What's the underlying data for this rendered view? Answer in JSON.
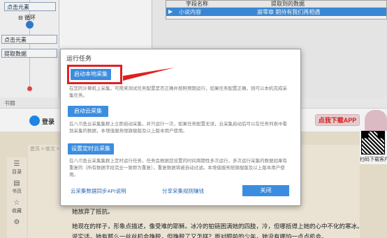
{
  "workflow": {
    "nodes": [
      "点击元素",
      "点击元素",
      "提取数据"
    ],
    "loop_label": "循环"
  },
  "grid": {
    "columns": [
      "字段名称",
      "提取到的数据"
    ],
    "rows": [
      {
        "name": "小说内容",
        "value": "崩零章 期待有我们再相遇"
      }
    ]
  },
  "browser": {
    "tab_label": "书籍",
    "login_label": "登录",
    "app_button": "点我下载APP",
    "qr_label": "扫码下载客户端",
    "breadcrumb": "首页 > 收文 >",
    "sidebar": [
      {
        "icon": "list-icon",
        "label": "目录"
      },
      {
        "icon": "page-icon",
        "label": "书页"
      },
      {
        "icon": "star-icon",
        "label": "收藏"
      },
      {
        "icon": "gear-icon",
        "label": ""
      }
    ],
    "paragraphs": [
      "她放弃了抵抗。",
      "她现在的样子，形象点描述，像受难的耶稣。冰冷的铂链困满她的四肢，冷，但哪抵得上她的心中不化的寒冰。",
      "说实话，她有那么一丝丝机会挣脱，但挣脱了又怎样？面对眼前的少年，她没有哪怕一点点机会。"
    ]
  },
  "modal": {
    "title": "运行任务",
    "local_button": "启动本地采集",
    "local_desc": "在您的计算机上采集，可用来测试任务配置是否正确并按照预期运行，如果任务配置正确，则可以本机完成采集任务。",
    "cloud_button": "启动云采集",
    "cloud_desc": "在八爪鱼云采集集群上立即启动采集，并只运行一次，如果任务配置无误，云采集启动后可以在任务列表中看到采集的数据，本增值服务限旗舰版及以上版本用户使用。",
    "schedule_button": "设置定时云采集",
    "schedule_desc": "在八爪鱼云采集集群上定时运行任务，任务会根据您设置的时间周期性多次运行，多次运行采集的数据如果有重复的（所有数据字段完全一致即为重复），重复数据将被自动过滤。本增值服务限旗舰版及以上版本用户使用。",
    "api_link": "云采集数据同步API说明",
    "share_link": "分享采集规则赚钱",
    "close_button": "关闭"
  }
}
